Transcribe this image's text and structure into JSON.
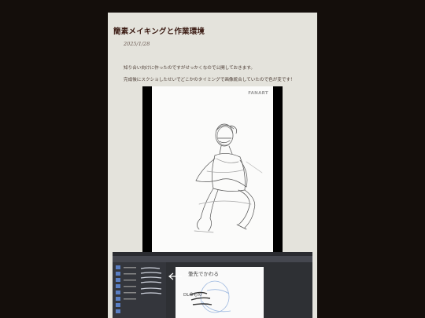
{
  "post": {
    "title": "簡素メイキングと作業環境",
    "date": "2025/1/28",
    "paragraphs": [
      "知り合い向けに作ったのですがせっかくなので公開しておきます。",
      "完成後にスクショしたせいでどこかのタイミングで画像統合していたので色が変です！"
    ]
  },
  "image1": {
    "watermark": "FANART"
  },
  "image2": {
    "annotation": "筆先でかわる",
    "annotation2": "DLのもの"
  }
}
